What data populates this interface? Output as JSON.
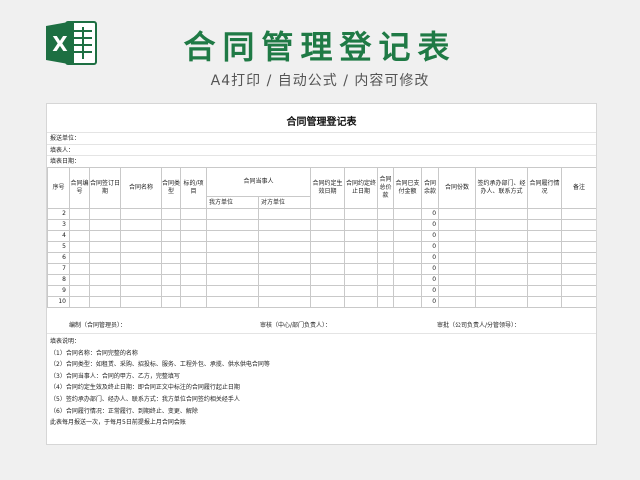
{
  "banner": {
    "title": "合同管理登记表",
    "subtitle": "A4打印 / 自动公式 / 内容可修改"
  },
  "sheet": {
    "title": "合同管理登记表",
    "info": [
      "报送单位：",
      "填表人：",
      "填表日期："
    ],
    "headers": {
      "seq": "序号",
      "contract_no": "合同编号",
      "sign_date": "合同签订日期",
      "name": "合同名称",
      "type": "合同类型",
      "subject": "标的/项目",
      "parties": "合同当事人",
      "our_party": "我方单位",
      "other_party": "对方单位",
      "effective_date": "合同约定生效日期",
      "end_date": "合同约定终止日期",
      "total_price": "合同总价款",
      "paid": "合同已支付金额",
      "balance": "合同余款",
      "copies": "合同份数",
      "contact": "签约承办部门、经办人、联系方式",
      "performance": "合同履行情况",
      "remarks": "备注"
    },
    "rows": [
      {
        "n": "2",
        "balance": "0"
      },
      {
        "n": "3",
        "balance": "0"
      },
      {
        "n": "4",
        "balance": "0"
      },
      {
        "n": "5",
        "balance": "0"
      },
      {
        "n": "6",
        "balance": "0"
      },
      {
        "n": "7",
        "balance": "0"
      },
      {
        "n": "8",
        "balance": "0"
      },
      {
        "n": "9",
        "balance": "0"
      },
      {
        "n": "10",
        "balance": "0"
      }
    ],
    "footer": {
      "prepared": "编制（合同管理员）：",
      "reviewed": "审核（中心/部门负责人）：",
      "approved": "审批（公司负责人/分管领导）："
    },
    "notes": [
      "填表说明：",
      "（1）合同名称：合同完整的名称",
      "（2）合同类型：如租赁、采购、招投标、服务、工程外包、承揽、供水供电合同等",
      "（3）合同当事人：合同的甲方、乙方，完整填写",
      "（4）合同约定生效及终止日期：即合同正文中标注的合同履行起止日期",
      "（5）签约承办部门、经办人、联系方式：我方单位合同签约相关经手人",
      "（6）合同履行情况：正常履行、到期终止、变更、解除",
      "  此表每月报送一次，于每月5日前提报上月合同会账"
    ]
  },
  "colors": {
    "brand_green": "#1f7a45",
    "excel_green": "#1d6f42",
    "zero_red": "#d0312d"
  },
  "icons": {
    "app": "excel-icon"
  }
}
